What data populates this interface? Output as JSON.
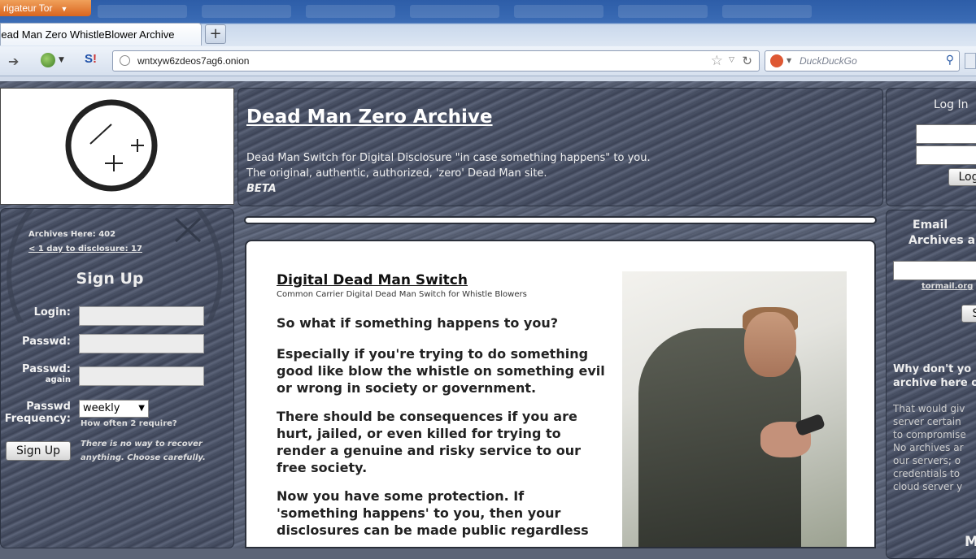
{
  "browser": {
    "app_menu": "rigateur Tor",
    "tab_title": "Dead Man Zero WhistleBlower Archive",
    "new_tab": "+",
    "url": "wntxyw6zdeos7ag6.onion",
    "search_placeholder": "DuckDuckGo"
  },
  "header": {
    "title": "Dead Man Zero Archive",
    "line1": "Dead Man Switch for Digital Disclosure \"in case something happens\" to you.",
    "line2": "The original, authentic, authorized, 'zero' Dead Man site.",
    "line3": "BETA"
  },
  "signup": {
    "archives": "Archives Here: 402",
    "disclosure": "< 1 day to disclosure: 17",
    "heading": "Sign Up",
    "login_label": "Login:",
    "passwd_label": "Passwd:",
    "passwd2_label": "Passwd:",
    "passwd2_sub": "again",
    "freq_label1": "Passwd",
    "freq_label2": "Frequency:",
    "freq_value": "weekly",
    "freq_hint": "How often 2 require?",
    "button": "Sign Up",
    "warning1": "There is no way to recover",
    "warning2": "anything. Choose carefully."
  },
  "content": {
    "heading": "Digital Dead Man Switch",
    "subheading": "Common Carrier Digital Dead Man Switch for Whistle Blowers",
    "p1": "So what if something happens to you?",
    "p2": "Especially if you're trying to do something good like blow the whistle on something evil or wrong in society or government.",
    "p3": "There should be consequences if you are hurt, jailed, or even killed for trying to render a genuine and risky service to our free society.",
    "p4": "Now you have some protection.  If 'something happens' to you, then your disclosures can be made public regardless"
  },
  "login_panel": {
    "title": "Log In",
    "button": "Log"
  },
  "email_panel": {
    "title1": "Email",
    "title2": "Archives a",
    "domain": "tormail.org",
    "button": "S",
    "why1": "Why don't yo",
    "why2": "archive here o",
    "t1": "That would giv",
    "t2": "server certain",
    "t3": "to compromise",
    "t4": "No archives ar",
    "t5": "our servers; o",
    "t6": "credentials to",
    "t7": "cloud server y",
    "m": "M"
  }
}
